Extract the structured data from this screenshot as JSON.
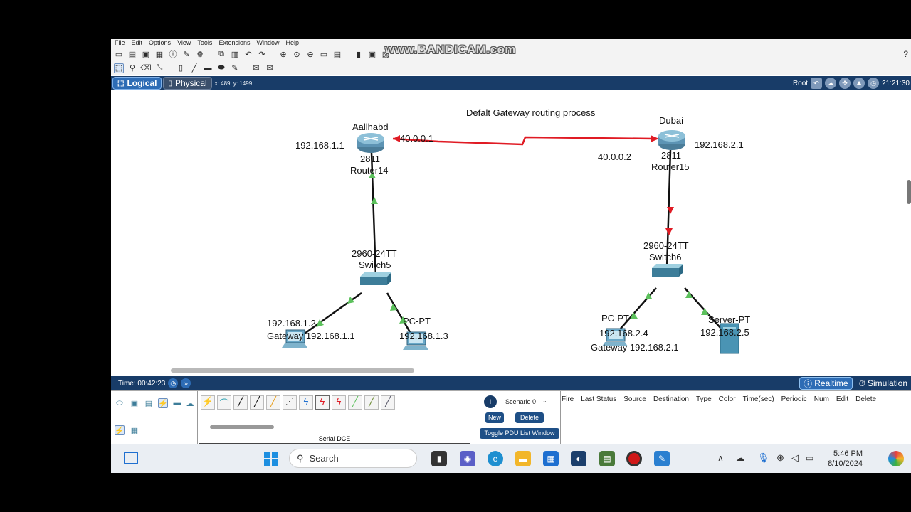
{
  "menu": [
    "File",
    "Edit",
    "Options",
    "View",
    "Tools",
    "Extensions",
    "Window",
    "Help"
  ],
  "watermark": "www.BANDICAM.com",
  "help_icon": "?",
  "workspace": {
    "tab_logical": "Logical",
    "tab_physical": "Physical",
    "coords": "x: 489, y: 1499",
    "root_label": "Root",
    "time": "21:21:30"
  },
  "topology": {
    "title": "Defalt Gateway routing process",
    "router_left": {
      "name": "Aallhabd",
      "model": "2811",
      "label": "Router14",
      "ip": "192.168.1.1",
      "wan_ip": "40.0.0.1"
    },
    "router_right": {
      "name": "Dubai",
      "model": "2811",
      "label": "Router15",
      "ip": "192.168.2.1",
      "wan_ip": "40.0.0.2"
    },
    "switch_left": {
      "model": "2960-24TT",
      "label": "Switch5"
    },
    "switch_right": {
      "model": "2960-24TT",
      "label": "Switch6"
    },
    "pc_left_1": {
      "ip": "192.168.1.2",
      "gateway": "Gateway 192.168.1.1"
    },
    "pc_left_2": {
      "type": "PC-PT",
      "ip": "192.168.1.3"
    },
    "pc_right": {
      "type": "PC-PT",
      "ip": "192.168.2.4",
      "gateway": "Gateway 192.168.2.1"
    },
    "server_right": {
      "type": "Server-PT",
      "ip": "192.168.2.5"
    }
  },
  "timebar": {
    "time": "Time: 00:42:23",
    "realtime": "Realtime",
    "simulation": "Simulation"
  },
  "bottom": {
    "connection_name": "Serial DCE",
    "scenario": "Scenario 0",
    "new_btn": "New",
    "delete_btn": "Delete",
    "toggle_btn": "Toggle PDU List Window",
    "pdu_columns": [
      "Fire",
      "Last Status",
      "Source",
      "Destination",
      "Type",
      "Color",
      "Time(sec)",
      "Periodic",
      "Num",
      "Edit",
      "Delete"
    ]
  },
  "taskbar": {
    "search": "Search",
    "clock_time": "5:46 PM",
    "clock_date": "8/10/2024"
  },
  "colors": {
    "link_red": "#e01b24",
    "link_black": "#111111",
    "port_green": "#5cc15c",
    "bar_blue": "#183c68"
  }
}
